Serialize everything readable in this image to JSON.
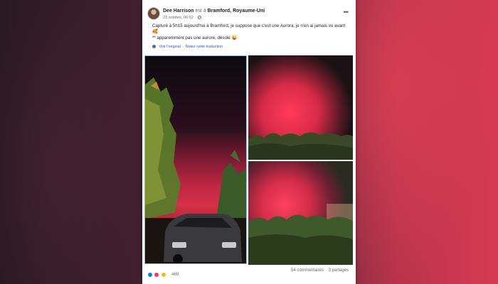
{
  "post": {
    "author": "Dee Harrison",
    "location_prefix": "est à",
    "location": "Bramford, Royaume-Uni",
    "timestamp": "23 octobre, 06:52 ·",
    "body": [
      "Capturé à 5h15 aujourd'hui à Bramford, je suppose que c'est une Aurora, je n'en ai jamais vu avant 🥰",
      "** apparemment pas une aurore, désolé 😜"
    ],
    "see_original": "Voir l'original",
    "rate_translation": "Notez cette traduction",
    "translate_separator": "·"
  },
  "photos": [
    {
      "name": "photo-car-pink-sky"
    },
    {
      "name": "photo-pink-glow-top"
    },
    {
      "name": "photo-pink-glow-bottom"
    }
  ],
  "footer": {
    "reaction_count": "469",
    "comments": "54 commentaires",
    "shares": "3 partages"
  },
  "colors": {
    "like": "#1877f2",
    "love": "#f33e58",
    "haha": "#f7b928",
    "link": "#385898",
    "sky_pink": "#e8334f"
  },
  "icons": [
    "more-icon",
    "globe-icon",
    "gear-icon",
    "like-icon",
    "love-icon",
    "haha-icon"
  ]
}
